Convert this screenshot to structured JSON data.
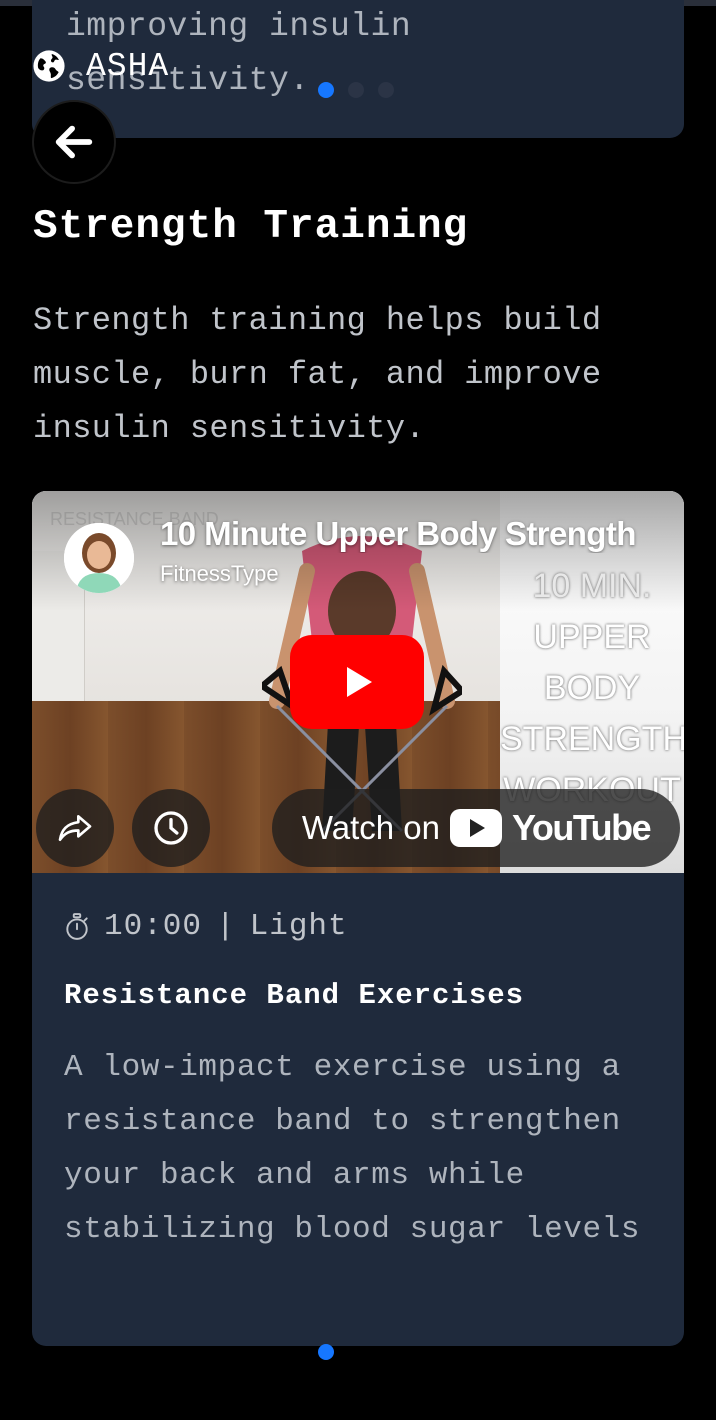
{
  "app": {
    "brand_name": "ASHA"
  },
  "previous_card": {
    "text": "improving insulin sensitivity."
  },
  "section": {
    "title": "Strength Training",
    "description": "Strength training helps build muscle, burn fat, and improve insulin sensitivity."
  },
  "video": {
    "title": "10 Minute Upper Body Strength",
    "channel": "FitnessType",
    "overlay_text": [
      "10 MIN.",
      "UPPER",
      "BODY",
      "STRENGTH",
      "WORKOUT"
    ],
    "ghost_text": "RESISTANCE BAND",
    "watch_on_label": "Watch on",
    "youtube_label": "YouTube",
    "play_color": "#ff0000"
  },
  "exercise": {
    "duration": "10:00",
    "separator": "|",
    "intensity": "Light",
    "title": "Resistance Band Exercises",
    "description": "A low-impact exercise using a resistance band to strengthen your back and arms while stabilizing blood sugar levels"
  },
  "colors": {
    "background": "#000000",
    "card": "#1f2a3c",
    "accent": "#1677ff",
    "inactive_dot": "#2b3446"
  },
  "icons": {
    "brand": "globe-icon",
    "back": "arrow-left-icon",
    "share": "share-icon",
    "watch_later": "clock-icon",
    "timer": "stopwatch-icon",
    "play": "play-icon"
  }
}
